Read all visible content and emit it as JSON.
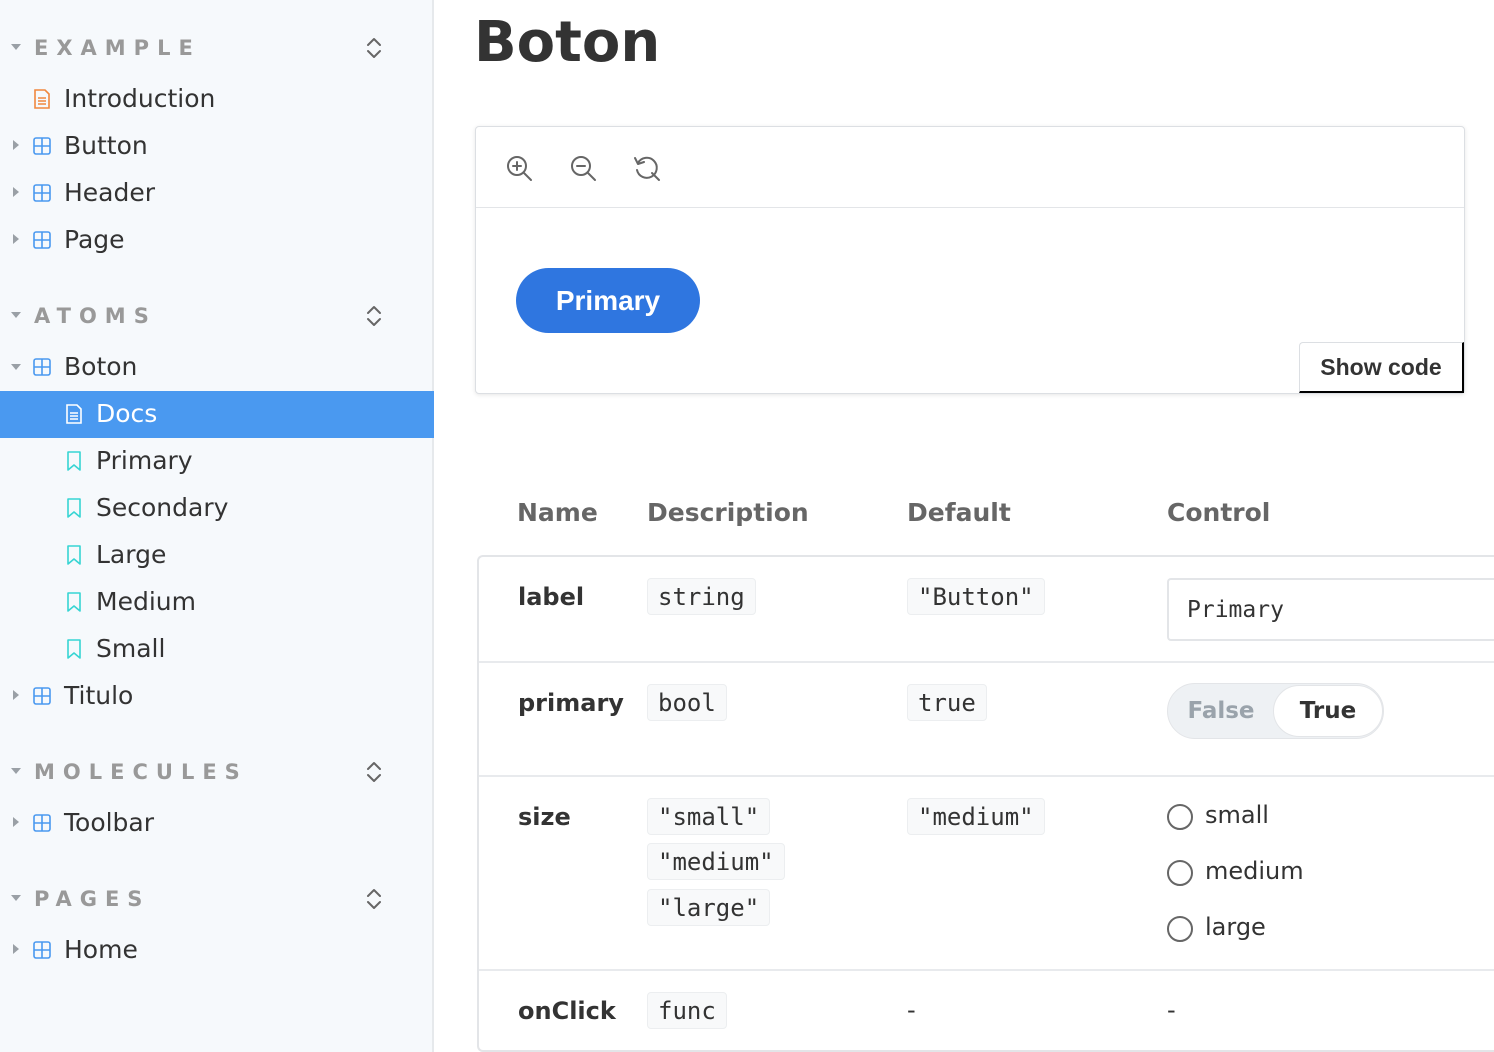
{
  "sidebar": {
    "sections": [
      {
        "title": "EXAMPLE",
        "items": [
          {
            "label": "Introduction",
            "icon": "doc-icon"
          },
          {
            "label": "Button",
            "icon": "component-icon"
          },
          {
            "label": "Header",
            "icon": "component-icon"
          },
          {
            "label": "Page",
            "icon": "component-icon"
          }
        ]
      },
      {
        "title": "ATOMS",
        "items": [
          {
            "label": "Boton",
            "icon": "component-icon",
            "expanded": true
          },
          {
            "label": "Docs",
            "icon": "doc-icon",
            "selected": true
          },
          {
            "label": "Primary",
            "icon": "bookmark-icon"
          },
          {
            "label": "Secondary",
            "icon": "bookmark-icon"
          },
          {
            "label": "Large",
            "icon": "bookmark-icon"
          },
          {
            "label": "Medium",
            "icon": "bookmark-icon"
          },
          {
            "label": "Small",
            "icon": "bookmark-icon"
          },
          {
            "label": "Titulo",
            "icon": "component-icon"
          }
        ]
      },
      {
        "title": "MOLECULES",
        "items": [
          {
            "label": "Toolbar",
            "icon": "component-icon"
          }
        ]
      },
      {
        "title": "PAGES",
        "items": [
          {
            "label": "Home",
            "icon": "component-icon"
          }
        ]
      }
    ]
  },
  "main": {
    "title": "Boton",
    "preview": {
      "tools": [
        "zoom-in-icon",
        "zoom-out-icon",
        "reset-zoom-icon"
      ],
      "button_label": "Primary",
      "show_code_label": "Show code"
    },
    "args_table": {
      "headers": [
        "Name",
        "Description",
        "Default",
        "Control"
      ],
      "rows": [
        {
          "name": "label",
          "description": [
            "string"
          ],
          "default": "\"Button\"",
          "control_value": "Primary"
        },
        {
          "name": "primary",
          "description": [
            "bool"
          ],
          "default": "true",
          "control_options": [
            "False",
            "True"
          ],
          "control_selected": "True"
        },
        {
          "name": "size",
          "description": [
            "\"small\"",
            "\"medium\"",
            "\"large\""
          ],
          "default": "\"medium\"",
          "control_options": [
            "small",
            "medium",
            "large"
          ]
        },
        {
          "name": "onClick",
          "description": [
            "func"
          ],
          "default": "-",
          "control_value": "-"
        }
      ]
    }
  },
  "colors": {
    "sidebar_bg": "#f6f9fc",
    "selected_bg": "#4a99f0",
    "primary_button": "#2f76e0",
    "component_icon": "#4a99f0",
    "doc_icon": "#f0883e",
    "bookmark_icon": "#37d5d3"
  }
}
